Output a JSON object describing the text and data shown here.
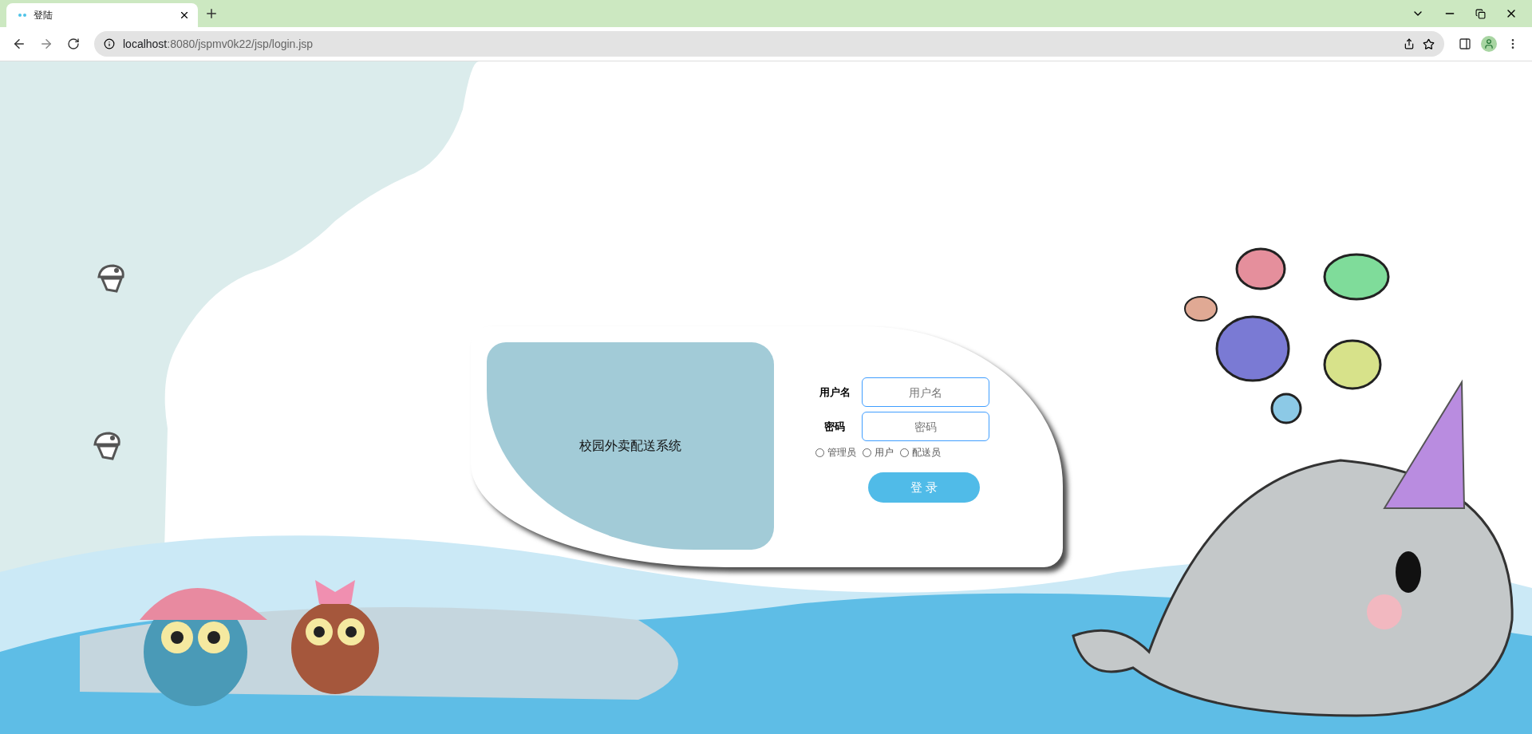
{
  "browser": {
    "tab_title": "登陆",
    "url_host": "localhost",
    "url_path": ":8080/jspmv0k22/jsp/login.jsp"
  },
  "login_card": {
    "system_title": "校园外卖配送系统",
    "fields": [
      {
        "label": "用户名",
        "placeholder": "用户名"
      },
      {
        "label": "密码",
        "placeholder": "密码"
      }
    ],
    "roles": [
      {
        "label": "管理员",
        "selected": false
      },
      {
        "label": "用户",
        "selected": false
      },
      {
        "label": "配送员",
        "selected": false
      }
    ],
    "submit": "登 录"
  }
}
